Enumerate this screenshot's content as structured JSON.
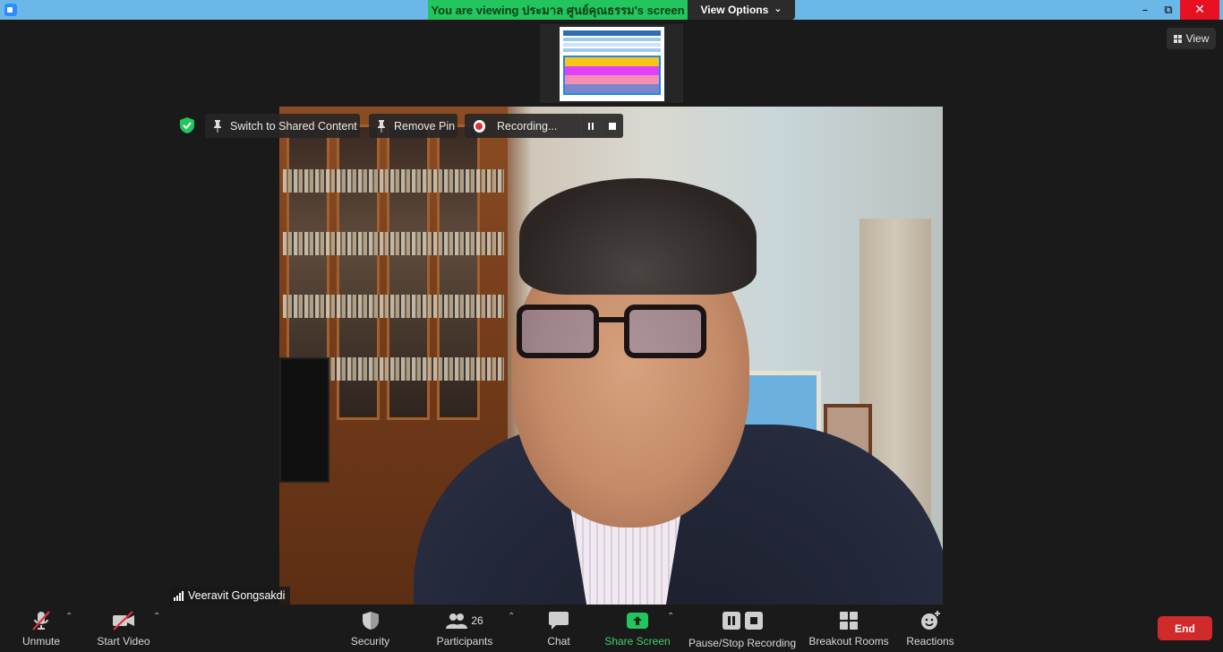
{
  "banner": {
    "viewing_text": "You are viewing ประมาล ศูนย์คุณธรรม's screen",
    "view_options": "View Options",
    "view_options_caret": "⌄"
  },
  "window": {
    "minimize": "–",
    "restore": "⧉",
    "close": "✕"
  },
  "top_right": {
    "view_label": "View"
  },
  "overlays": {
    "switch_label": "Switch to Shared Content",
    "remove_pin_label": "Remove Pin",
    "recording_label": "Recording..."
  },
  "participant": {
    "name": "Veeravit Gongsakdi"
  },
  "toolbar": {
    "unmute": "Unmute",
    "start_video": "Start Video",
    "security": "Security",
    "participants": "Participants",
    "participants_count": "26",
    "chat": "Chat",
    "share_screen": "Share Screen",
    "pause_stop_recording": "Pause/Stop Recording",
    "breakout_rooms": "Breakout Rooms",
    "reactions": "Reactions",
    "caret": "⌃"
  },
  "end_button": "End",
  "colors": {
    "accent_green": "#22c55e",
    "end_red": "#d02a2a",
    "titlebar_blue": "#6bb8e8"
  },
  "icons": [
    "zoom-app-icon",
    "shield-check-icon",
    "pin-icon",
    "record-icon",
    "pause-icon",
    "stop-icon",
    "signal-icon",
    "mic-muted-icon",
    "video-off-icon",
    "security-shield-icon",
    "participants-icon",
    "chat-icon",
    "share-screen-arrow-icon",
    "breakout-rooms-icon",
    "reactions-icon",
    "grid-view-icon"
  ]
}
